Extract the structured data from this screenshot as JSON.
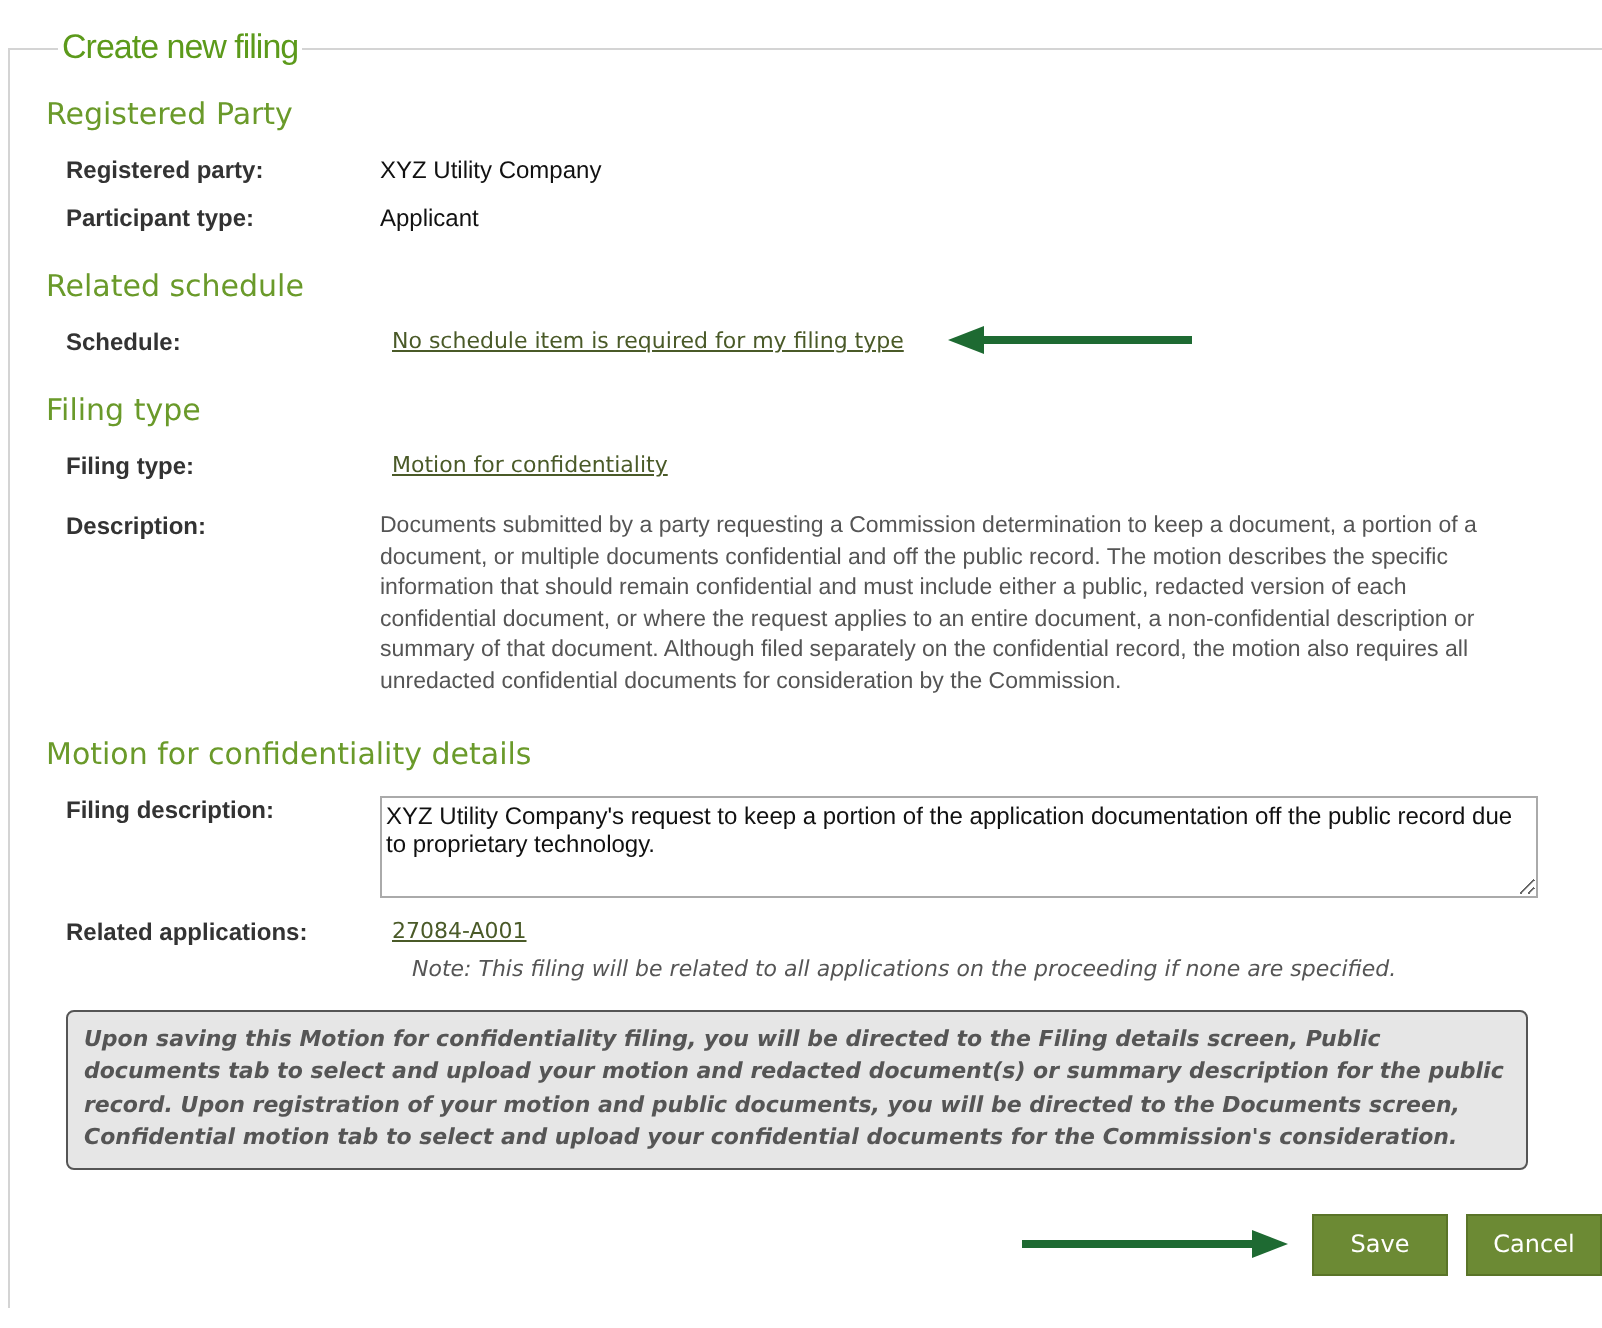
{
  "legend": "Create new filing",
  "sections": [
    {
      "heading": "Registered Party",
      "rows": [
        {
          "label": "Registered party:",
          "kind": "text",
          "value": "XYZ Utility Company"
        },
        {
          "label": "Participant type:",
          "kind": "text",
          "value": "Applicant"
        }
      ]
    },
    {
      "heading": "Related schedule",
      "rows": [
        {
          "label": "Schedule:",
          "kind": "link",
          "value": "No schedule item is required for my filing type",
          "annotated": true
        }
      ]
    },
    {
      "heading": "Filing type",
      "rows": [
        {
          "label": "Filing type:",
          "kind": "link",
          "value": "Motion for confidentiality"
        },
        {
          "label": "Description:",
          "kind": "paragraph",
          "value": "Documents submitted by a party requesting a Commission determination to keep a document, a portion of a document, or multiple documents confidential and off the public record. The motion describes the specific information that should remain confidential and must include either a public, redacted version of each confidential document, or where the request applies to an entire document, a non-confidential description or summary of that document. Although filed separately on the confidential record, the motion also requires all unredacted confidential documents for consideration by the Commission."
        }
      ]
    },
    {
      "heading": "Motion for confidentiality details",
      "rows": [
        {
          "label": "Filing description:",
          "kind": "textarea",
          "value": "XYZ Utility Company's request to keep a portion of the application documentation off the public record due to proprietary technology."
        },
        {
          "label": "Related applications:",
          "kind": "link",
          "value": "27084-A001",
          "note": "Note: This filing will be related to all applications on the proceeding if none are specified."
        }
      ]
    }
  ],
  "info": "Upon saving this Motion for confidentiality filing, you will be directed to the Filing details screen, Public documents tab to select and upload your motion and redacted document(s) or summary description for the public record. Upon registration of your motion and public documents, you will be directed to the Documents screen, Confidential motion tab to select and upload your confidential documents for the Commission's consideration.",
  "buttons": [
    {
      "label": "Save",
      "annotated": true
    },
    {
      "label": "Cancel"
    }
  ]
}
